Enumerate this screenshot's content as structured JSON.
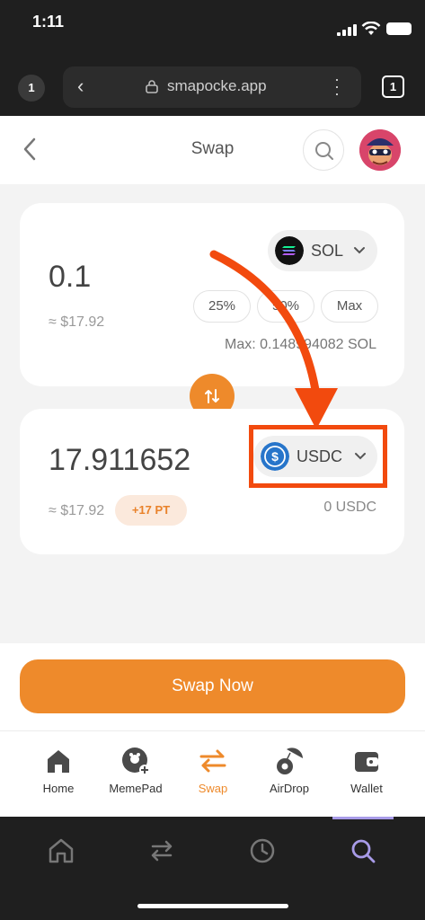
{
  "status_bar": {
    "time": "1:11"
  },
  "browser": {
    "tab_count_left": "1",
    "url": "smapocke.app",
    "tabs_count": "1"
  },
  "header": {
    "title": "Swap"
  },
  "from": {
    "amount": "0.1",
    "fiat": "≈ $17.92",
    "token": "SOL",
    "pct_buttons": [
      "25%",
      "50%",
      "Max"
    ],
    "max_text": "Max: 0.148994082 SOL"
  },
  "to": {
    "amount": "17.911652",
    "fiat": "≈ $17.92",
    "points_badge": "+17 PT",
    "token": "USDC",
    "balance": "0 USDC"
  },
  "swap_button": "Swap Now",
  "nav": [
    {
      "label": "Home",
      "icon": "home-icon"
    },
    {
      "label": "MemePad",
      "icon": "memepad-icon"
    },
    {
      "label": "Swap",
      "icon": "swap-arrows-icon",
      "active": true
    },
    {
      "label": "AirDrop",
      "icon": "airdrop-icon"
    },
    {
      "label": "Wallet",
      "icon": "wallet-icon"
    }
  ],
  "colors": {
    "accent": "#ee8a2b",
    "annotation": "#f24a0e",
    "browser_chrome": "#1f1f1f",
    "background": "#f3f3f3"
  }
}
